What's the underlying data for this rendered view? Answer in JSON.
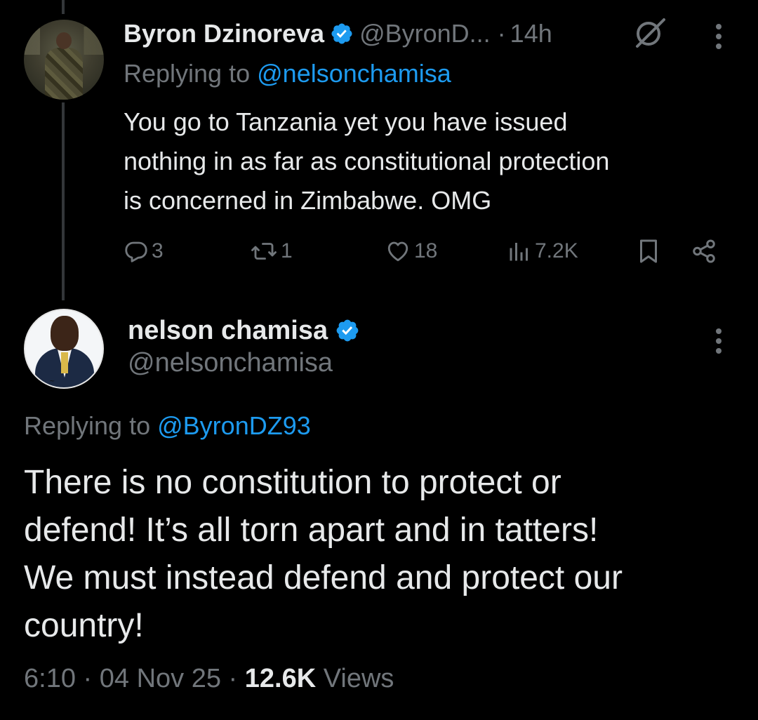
{
  "reply_tweet": {
    "author": {
      "display_name": "Byron Dzinoreva",
      "handle": "@ByronD...",
      "verified": true,
      "avatar_icon": "profile-photo"
    },
    "separator": "·",
    "timestamp": "14h",
    "replying_to_label": "Replying to",
    "replying_to_handle": "@nelsonchamisa",
    "text_lines": [
      "You go to Tanzania yet you have issued",
      "nothing in as far as constitutional protection",
      "is concerned in Zimbabwe. OMG"
    ],
    "actions": {
      "replies": "3",
      "reposts": "1",
      "likes": "18",
      "views": "7.2K"
    },
    "icons": [
      "grok-icon",
      "more-icon",
      "reply-icon",
      "repost-icon",
      "like-icon",
      "views-icon",
      "bookmark-icon",
      "share-icon"
    ]
  },
  "main_tweet": {
    "author": {
      "display_name": "nelson chamisa",
      "handle": "@nelsonchamisa",
      "verified": true,
      "avatar_icon": "profile-photo"
    },
    "replying_to_label": "Replying to",
    "replying_to_handle": "@ByronDZ93",
    "text_lines": [
      "There is no constitution to protect or",
      "defend! It’s all torn apart and in tatters!",
      "We must instead defend and protect our",
      "country!"
    ],
    "time": "6:10",
    "date": "04 Nov 25",
    "separator": "·",
    "views_count": "12.6K",
    "views_label": "Views"
  },
  "colors": {
    "background": "#000000",
    "text": "#e7e9ea",
    "secondary": "#71767b",
    "accent": "#1d9bf0",
    "thread_line": "#333639"
  }
}
